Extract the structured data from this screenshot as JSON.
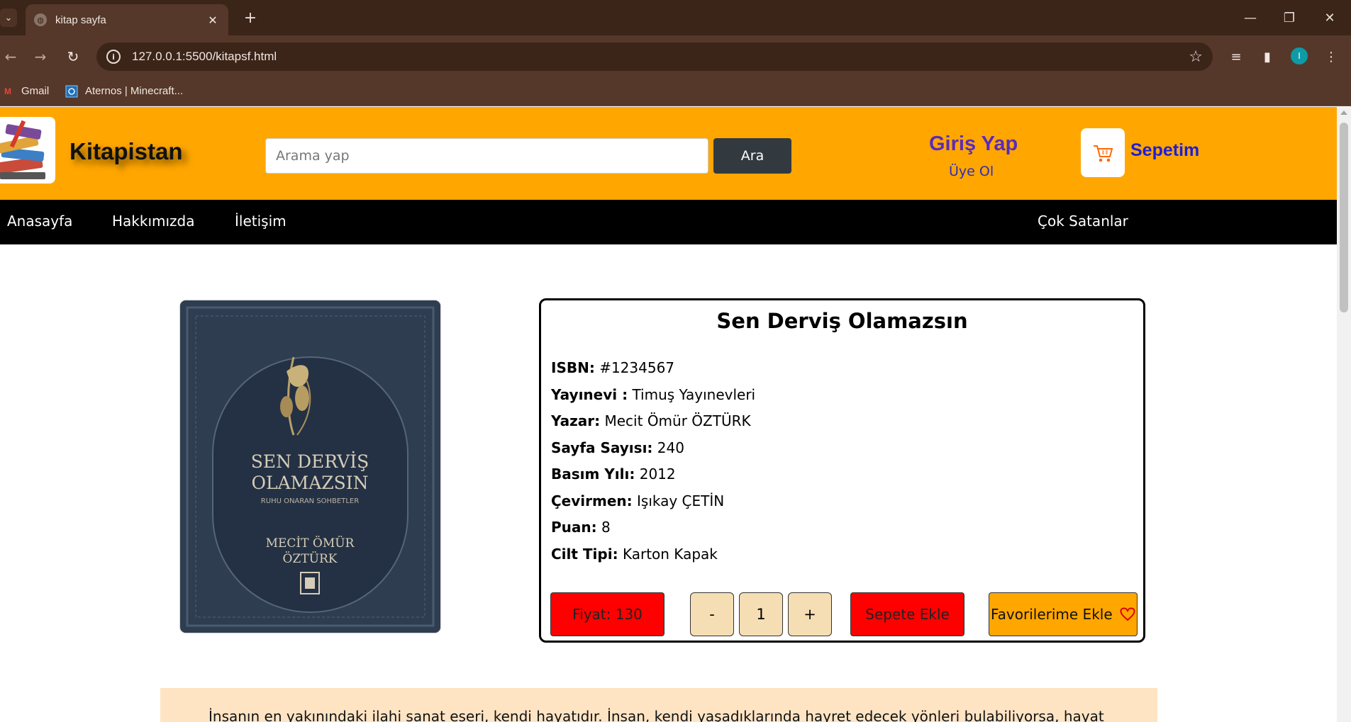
{
  "browser": {
    "tab_title": "kitap sayfa",
    "url": "127.0.0.1:5500/kitapsf.html",
    "profile_initial": "I",
    "bookmarks": [
      {
        "label": "Gmail",
        "icon": "gmail-icon"
      },
      {
        "label": "Aternos | Minecraft...",
        "icon": "aternos-icon"
      }
    ]
  },
  "header": {
    "brand": "Kitapistan",
    "search_placeholder": "Arama yap",
    "search_button": "Ara",
    "login": "Giriş Yap",
    "signup": "Üye Ol",
    "cart": "Sepetim"
  },
  "nav": {
    "items": [
      "Anasayfa",
      "Hakkımızda",
      "İletişim"
    ],
    "right_item": "Çok Satanlar"
  },
  "book": {
    "title": "Sen Derviş Olamazsın",
    "cover": {
      "title_line1": "SEN DERVİŞ",
      "title_line2": "OLAMAZSIN",
      "subtitle": "RUHU ONARAN SOHBETLER",
      "author_line1": "MECİT ÖMÜR",
      "author_line2": "ÖZTÜRK"
    },
    "details": [
      {
        "key": "ISBN:",
        "value": "#1234567"
      },
      {
        "key": "Yayınevi :",
        "value": "Timuş Yayınevleri"
      },
      {
        "key": "Yazar:",
        "value": "Mecit Ömür ÖZTÜRK"
      },
      {
        "key": "Sayfa Sayısı:",
        "value": "240"
      },
      {
        "key": "Basım Yılı:",
        "value": "2012"
      },
      {
        "key": "Çevirmen:",
        "value": "Işıkay ÇETİN"
      },
      {
        "key": "Puan:",
        "value": "8"
      },
      {
        "key": "Cilt Tipi:",
        "value": "Karton Kapak"
      }
    ],
    "price_label": "Fiyat: 130",
    "qty_minus": "-",
    "qty_value": "1",
    "qty_plus": "+",
    "add_to_cart": "Sepete Ekle",
    "add_to_favorites": "Favorilerime Ekle"
  },
  "description": "İnsanın en yakınındaki ilahi sanat eseri, kendi hayatıdır. İnsan, kendi yaşadıklarında hayret edecek yönleri bulabiliyorsa, hayat",
  "colors": {
    "header_bg": "#ffa600",
    "nav_bg": "#000000",
    "price_bg": "#ff0000",
    "qty_bg": "#f5deb3",
    "desc_bg": "#ffe4c4",
    "login_color": "#5b2bb8",
    "cart_label_color": "#1e1ed6"
  }
}
